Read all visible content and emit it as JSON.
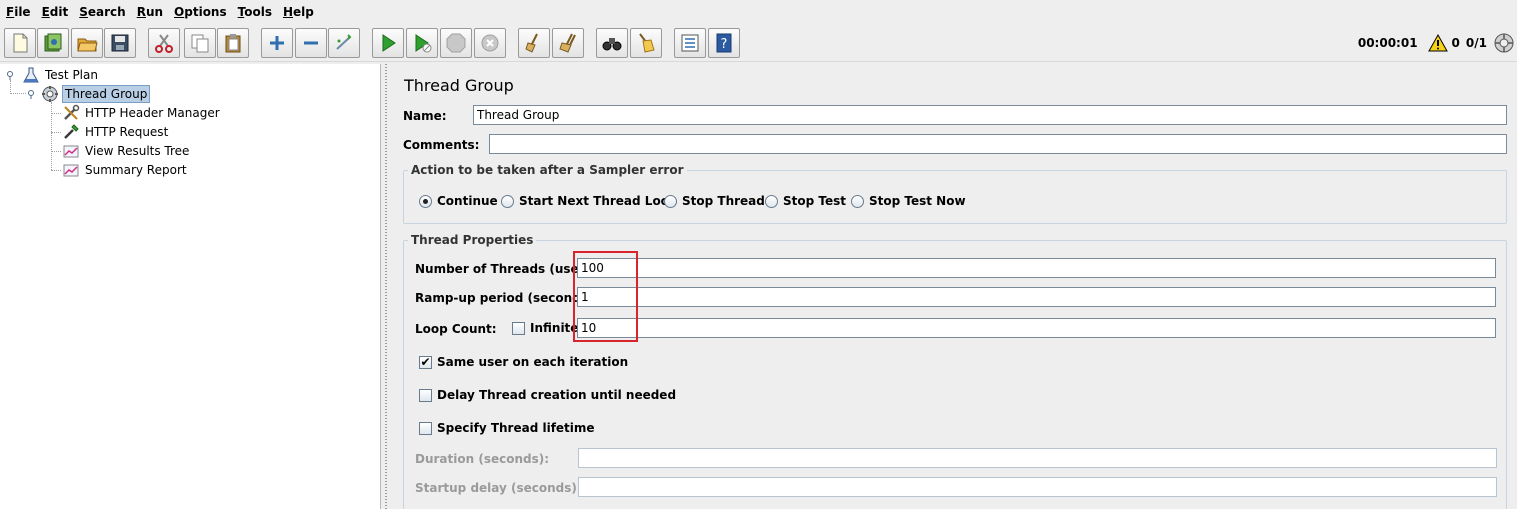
{
  "menu": [
    {
      "underline": "F",
      "rest": "ile"
    },
    {
      "underline": "E",
      "rest": "dit"
    },
    {
      "underline": "S",
      "rest": "earch"
    },
    {
      "underline": "R",
      "rest": "un"
    },
    {
      "underline": "O",
      "rest": "ptions"
    },
    {
      "underline": "T",
      "rest": "ools"
    },
    {
      "underline": "H",
      "rest": "elp"
    }
  ],
  "status": {
    "elapsed": "00:00:01",
    "warnings": "0",
    "threads": "0/1"
  },
  "tree": {
    "test_plan": "Test Plan",
    "thread_group": "Thread Group",
    "children": [
      "HTTP Header Manager",
      "HTTP Request",
      "View Results Tree",
      "Summary Report"
    ]
  },
  "panel": {
    "title": "Thread Group",
    "name_label": "Name:",
    "name_value": "Thread Group",
    "comments_label": "Comments:",
    "comments_value": "",
    "sampler_error": {
      "legend": "Action to be taken after a Sampler error",
      "options": [
        "Continue",
        "Start Next Thread Loop",
        "Stop Thread",
        "Stop Test",
        "Stop Test Now"
      ],
      "selected": "Continue"
    },
    "thread_props": {
      "legend": "Thread Properties",
      "num_threads_label": "Number of Threads (users):",
      "num_threads_value": "100",
      "rampup_label": "Ramp-up period (seconds):",
      "rampup_value": "1",
      "loop_label": "Loop Count:",
      "infinite_label": "Infinite",
      "infinite_checked": false,
      "loop_value": "10",
      "same_user_label": "Same user on each iteration",
      "same_user_checked": true,
      "delay_label": "Delay Thread creation until needed",
      "delay_checked": false,
      "lifetime_label": "Specify Thread lifetime",
      "lifetime_checked": false,
      "duration_label": "Duration (seconds):",
      "duration_value": "",
      "startup_label": "Startup delay (seconds):",
      "startup_value": ""
    }
  },
  "colors": {
    "highlight": "#d9232d",
    "selection": "#b8cfe5"
  }
}
